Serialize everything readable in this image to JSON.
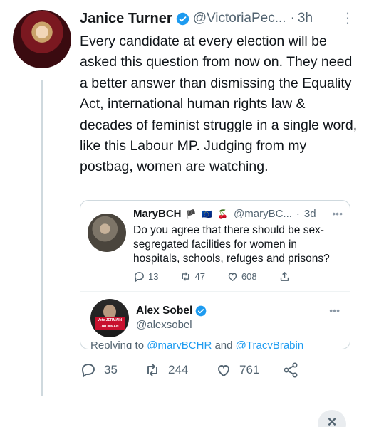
{
  "tweet": {
    "author_name": "Janice Turner",
    "author_handle": "@VictoriaPec...",
    "separator": "·",
    "time": "3h",
    "text": "Every candidate at every election will be asked this question from now on. They need a better answer than dismissing the Equality Act, international human rights law & decades of feminist struggle in a single word, like this Labour MP. Judging from my postbag, women are watching.",
    "reply_count": "35",
    "retweet_count": "244",
    "like_count": "761"
  },
  "quoted": {
    "author_name": "MaryBCH",
    "emoji": "🏴 🇪🇺 🍒",
    "author_handle": "@maryBC...",
    "separator": "·",
    "time": "3d",
    "text": "Do you agree that there should be sex-segregated facilities for women in hospitals, schools, refuges and prisons?",
    "reply_count": "13",
    "retweet_count": "47",
    "like_count": "608"
  },
  "reply": {
    "author_name": "Alex Sobel",
    "author_handle": "@alexsobel",
    "avatar_sign": "Vote JERMAIN JACKMAN",
    "replying_prefix": "Replying to",
    "replying_to_1": "@maryBCHR",
    "replying_and": "and",
    "replying_to_2": "@TracyBrabin"
  },
  "ui": {
    "more_icon": "⋮",
    "quote_more_icon": "•••",
    "close_icon": "×",
    "accent_color": "#1d9bf0",
    "verified_color": "#1d9bf0"
  }
}
